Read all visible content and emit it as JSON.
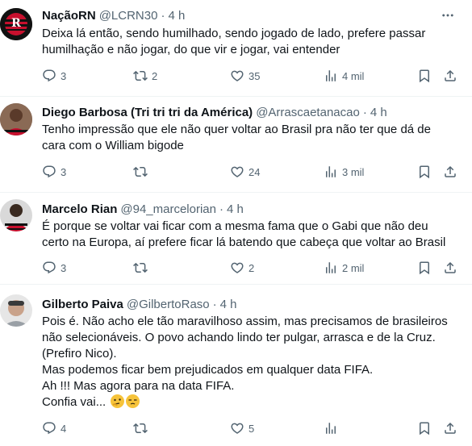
{
  "tweets": [
    {
      "name": "NaçãoRN",
      "handle": "@LCRN30",
      "sep": "·",
      "time": "4 h",
      "lines": [
        "Deixa lá então, sendo humilhado, sendo jogado de lado, prefere passar",
        "humilhação e não jogar, do que vir e jogar, vai entender"
      ],
      "replies": "3",
      "retweets": "2",
      "likes": "35",
      "views": "4 mil"
    },
    {
      "name": "Diego Barbosa (Tri tri tri da América)",
      "handle": "@Arrascaetanacao",
      "sep": "·",
      "time": "4 h",
      "lines": [
        "Tenho impressão que ele não quer voltar ao Brasil pra não ter que dá de",
        "cara com o William bigode"
      ],
      "replies": "3",
      "retweets": "",
      "likes": "24",
      "views": "3 mil"
    },
    {
      "name": "Marcelo Rian",
      "handle": "@94_marcelorian",
      "sep": "·",
      "time": "4 h",
      "lines": [
        "É porque se voltar vai ficar com a mesma fama que o Gabi que não deu",
        "certo na Europa, aí prefere ficar lá batendo que cabeça que voltar ao Brasil"
      ],
      "replies": "3",
      "retweets": "",
      "likes": "2",
      "views": "2 mil"
    },
    {
      "name": "Gilberto Paiva",
      "handle": "@GilbertoRaso",
      "sep": "·",
      "time": "4 h",
      "lines": [
        "Pois é. Não acho ele tão maravilhoso assim, mas precisamos de brasileiros",
        "não selecionáveis. O povo achando lindo ter pulgar, arrasca e de la Cruz.",
        "(Prefiro Nico).",
        "Mas podemos ficar bem prejudicados em qualquer data FIFA.",
        "Ah !!! Mas agora para na data FIFA.",
        "Confia vai..."
      ],
      "emojis": [
        "thinking-face-emoji",
        "unamused-face-emoji"
      ],
      "replies": "4",
      "retweets": "",
      "likes": "5",
      "views": ""
    }
  ],
  "icons": {
    "more": "more-icon",
    "reply": "reply-icon",
    "retweet": "retweet-icon",
    "like": "like-icon",
    "views": "views-icon",
    "bookmark": "bookmark-icon",
    "share": "share-icon"
  },
  "colors": {
    "text": "#0f1419",
    "secondary": "#536471",
    "divider": "#eff3f4",
    "flamengo_red": "#c8102e"
  }
}
